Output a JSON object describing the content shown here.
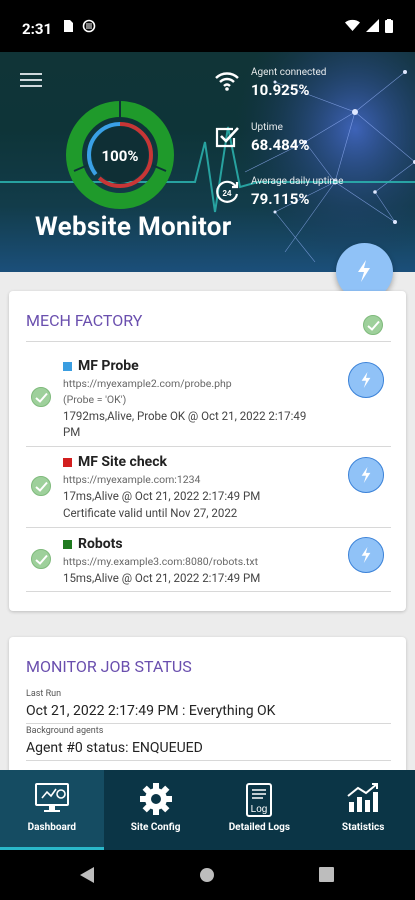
{
  "status_bar": {
    "time": "2:31"
  },
  "hero": {
    "title": "Website Monitor",
    "donut_percent": "100%",
    "stats": [
      {
        "label": "Agent connected",
        "value": "10.925%",
        "icon": "wifi-icon"
      },
      {
        "label": "Uptime",
        "value": "68.484%",
        "icon": "check-box-icon"
      },
      {
        "label": "Average daily uptime",
        "value": "79.115%",
        "icon": "24h-icon"
      }
    ]
  },
  "mech_factory": {
    "title": "MECH FACTORY",
    "items": [
      {
        "name": "MF Probe",
        "color": "#3a9de0",
        "url": "https://myexample2.com/probe.php",
        "extra": "(Probe = 'OK')",
        "status1": "1792ms,Alive, Probe OK @ Oct 21, 2022 2:17:49",
        "status2": "PM"
      },
      {
        "name": "MF Site check",
        "color": "#d21f1f",
        "url": "https://myexample.com:1234",
        "status1": "17ms,Alive @ Oct 21, 2022 2:17:49 PM",
        "status2": "Certificate valid until Nov 27, 2022"
      },
      {
        "name": "Robots",
        "color": "#1f7a1f",
        "url": "https://my.example3.com:8080/robots.txt",
        "status1": "15ms,Alive @ Oct 21, 2022 2:17:49 PM"
      }
    ]
  },
  "job_status": {
    "title": "MONITOR JOB STATUS",
    "last_run_label": "Last Run",
    "last_run_value": "Oct 21, 2022 2:17:49 PM : Everything OK",
    "agents_label": "Background agents",
    "agents_value": "Agent #0 status: ENQUEUED"
  },
  "bottom_nav": {
    "items": [
      {
        "label": "Dashboard",
        "icon": "dashboard-monitor-icon",
        "active": true
      },
      {
        "label": "Site Config",
        "icon": "gear-icon",
        "active": false
      },
      {
        "label": "Detailed Logs",
        "icon": "log-icon",
        "active": false
      },
      {
        "label": "Statistics",
        "icon": "chart-icon",
        "active": false
      }
    ]
  },
  "colors": {
    "accent": "#6a4fae",
    "fab": "#90c2f7",
    "nav_bg": "#0b3546",
    "ok": "#9ed09b"
  }
}
